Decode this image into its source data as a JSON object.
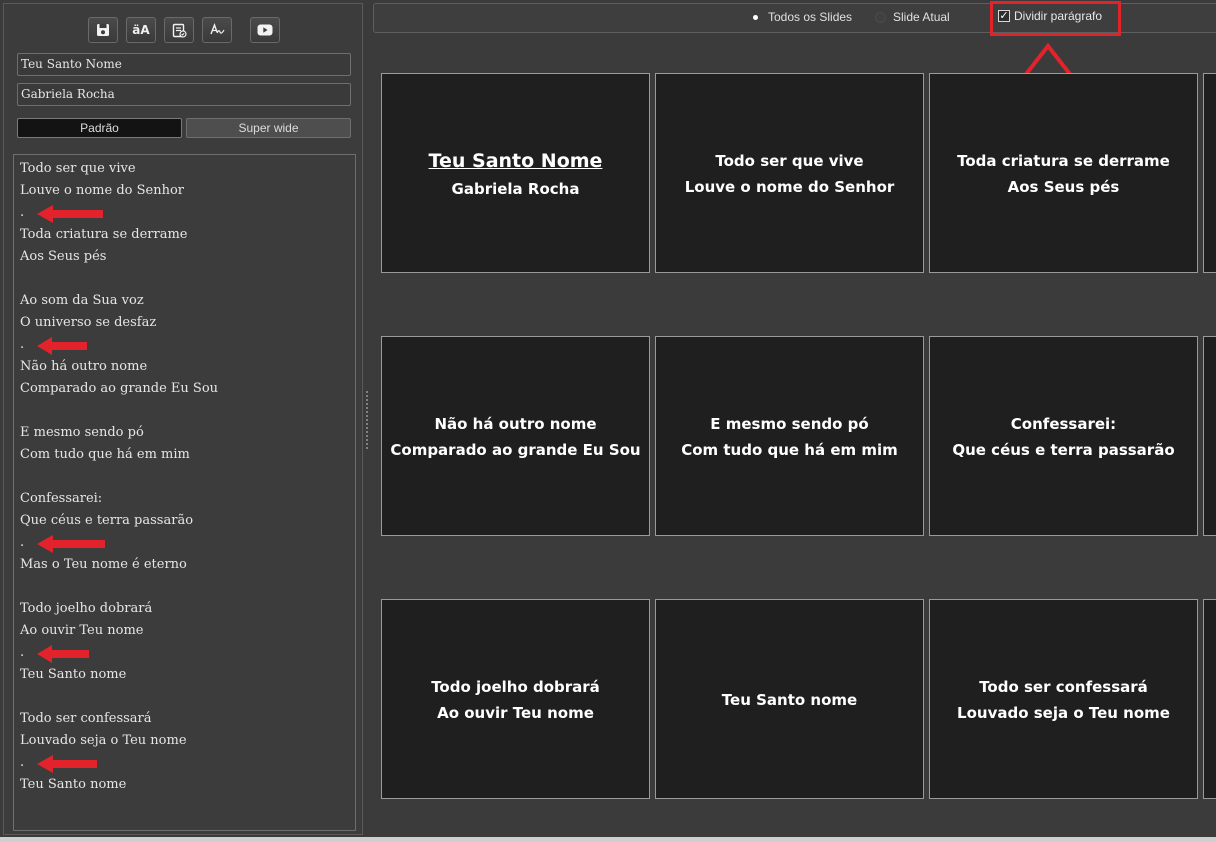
{
  "editor": {
    "toolbar": {
      "save_icon": "save-icon",
      "font_case_label": "äA",
      "check_icon": "document-check-icon",
      "spell_icon": "spellcheck-icon",
      "youtube_icon": "youtube-icon"
    },
    "song_title": "Teu Santo Nome",
    "artist": "Gabriela Rocha",
    "modes": [
      "Padrão",
      "Super wide"
    ],
    "active_mode": "Padrão",
    "lyrics": [
      "Todo ser que vive",
      "Louve o nome do Senhor",
      ".",
      "Toda criatura se derrame",
      "Aos Seus pés",
      "",
      "Ao som da Sua voz",
      "O universo se desfaz",
      ".",
      "Não há outro nome",
      "Comparado ao grande Eu Sou",
      "",
      "E mesmo sendo pó",
      "Com tudo que há em mim",
      "",
      "Confessarei:",
      "Que céus e terra passarão",
      ".",
      "Mas o Teu nome é eterno",
      "",
      "Todo joelho dobrará",
      "Ao ouvir Teu nome",
      ".",
      "Teu Santo nome",
      "",
      "Todo ser confessará",
      "Louvado seja o Teu nome",
      ".",
      "Teu Santo nome"
    ]
  },
  "options": {
    "radio_all": "Todos os Slides",
    "radio_current": "Slide Atual",
    "selected": "Todos os Slides",
    "split_paragraph_label": "Dividir parágrafo",
    "split_paragraph_checked": true
  },
  "annotation": {
    "color": "#e3232b"
  },
  "slides": [
    [
      "Teu Santo Nome",
      "Gabriela Rocha"
    ],
    [
      "Todo ser que vive",
      "Louve o nome do Senhor"
    ],
    [
      "Toda criatura se derrame",
      "Aos Seus pés"
    ],
    [
      "Não há outro nome",
      "Comparado ao grande Eu Sou"
    ],
    [
      "E mesmo sendo pó",
      "Com tudo que há em mim"
    ],
    [
      "Confessarei:",
      "Que céus e terra passarão"
    ],
    [
      "Todo joelho dobrará",
      "Ao ouvir Teu nome"
    ],
    [
      "Teu Santo nome"
    ],
    [
      "Todo ser confessará",
      "Louvado seja o Teu nome"
    ]
  ]
}
